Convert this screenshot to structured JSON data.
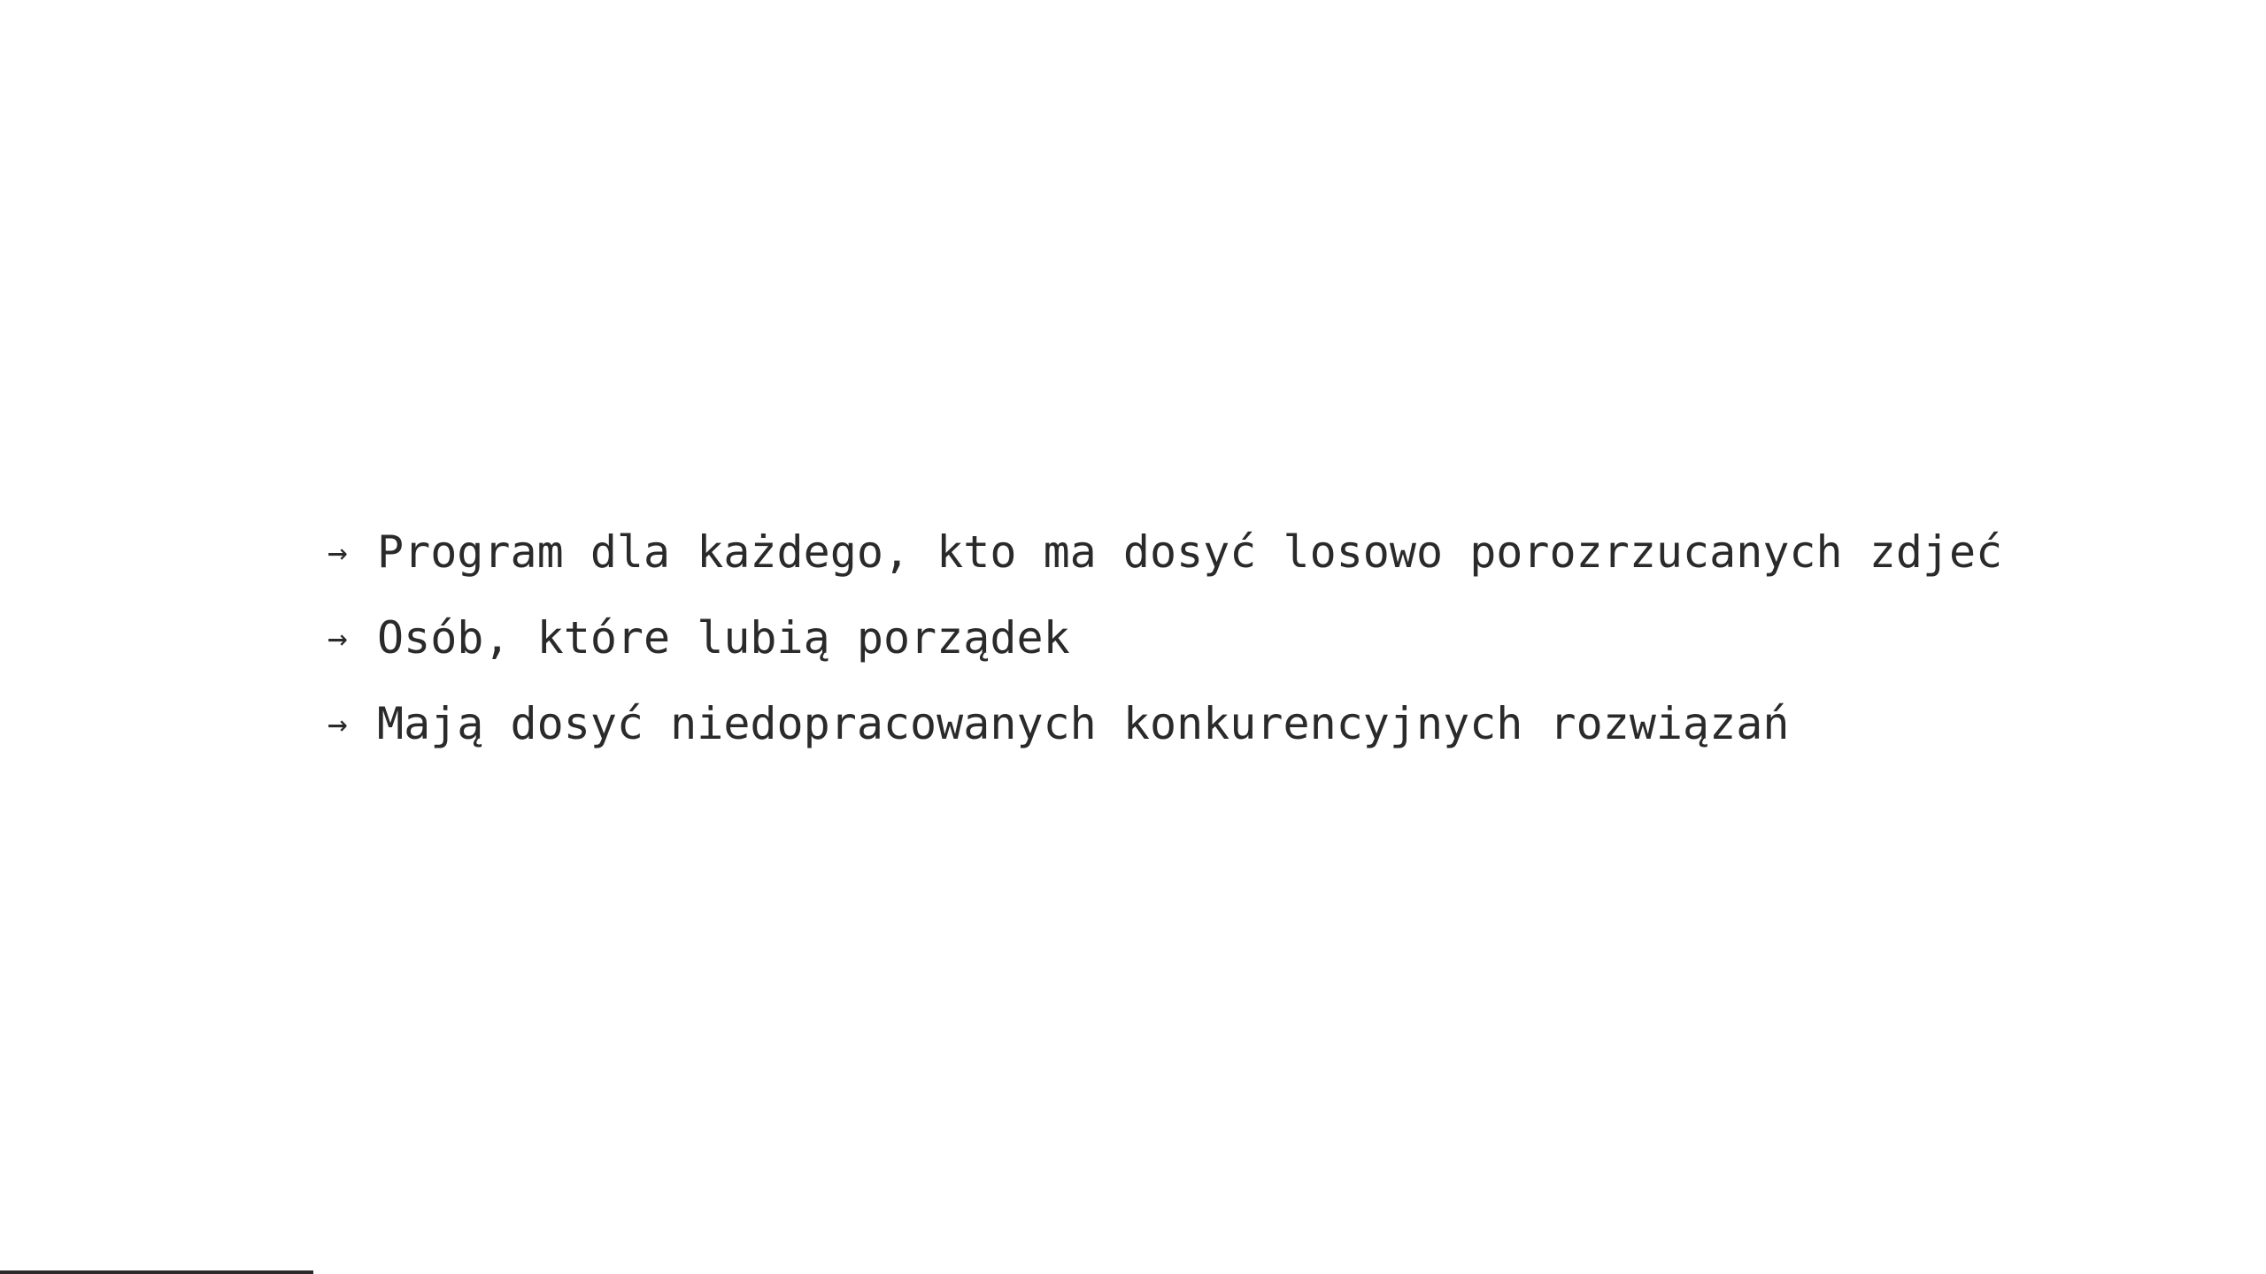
{
  "slide": {
    "bullets": [
      {
        "icon": "arrow-right-icon",
        "text": "Program dla każdego, kto ma dosyć losowo porozrzucanych zdjeć"
      },
      {
        "icon": "arrow-right-icon",
        "text": "Osób, które lubią porządek"
      },
      {
        "icon": "arrow-right-icon",
        "text": "Mają dosyć niedopracowanych konkurencyjnych rozwiązań"
      }
    ],
    "arrow_glyph": "→"
  },
  "colors": {
    "background": "#ffffff",
    "text": "#2a2a2a"
  }
}
